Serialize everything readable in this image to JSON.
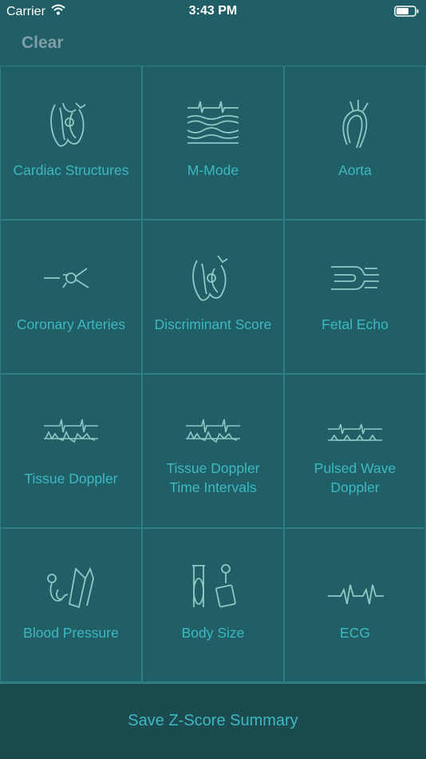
{
  "status": {
    "carrier": "Carrier",
    "time": "3:43 PM"
  },
  "nav": {
    "clear_label": "Clear"
  },
  "tiles": [
    {
      "label": "Cardiac Structures",
      "icon": "heart-icon"
    },
    {
      "label": "M-Mode",
      "icon": "m-mode-wave-icon"
    },
    {
      "label": "Aorta",
      "icon": "aorta-icon"
    },
    {
      "label": "Coronary Arteries",
      "icon": "coronary-artery-icon"
    },
    {
      "label": "Discriminant Score",
      "icon": "heart-icon"
    },
    {
      "label": "Fetal Echo",
      "icon": "fetal-echo-icon"
    },
    {
      "label": "Tissue Doppler",
      "icon": "doppler-waveform-icon"
    },
    {
      "label_line1": "Tissue Doppler",
      "label_line2": "Time Intervals",
      "icon": "doppler-waveform-icon"
    },
    {
      "label_line1": "Pulsed Wave",
      "label_line2": "Doppler",
      "icon": "pulsed-wave-icon"
    },
    {
      "label": "Blood Pressure",
      "icon": "blood-pressure-cuff-icon"
    },
    {
      "label": "Body Size",
      "icon": "scale-icon"
    },
    {
      "label": "ECG",
      "icon": "ecg-trace-icon"
    }
  ],
  "footer": {
    "save_label": "Save Z-Score Summary"
  },
  "colors": {
    "background": "#1f5f65",
    "accent": "#3eb8c2",
    "clear": "#7f9ea8",
    "footer": "#1b4a4f"
  }
}
